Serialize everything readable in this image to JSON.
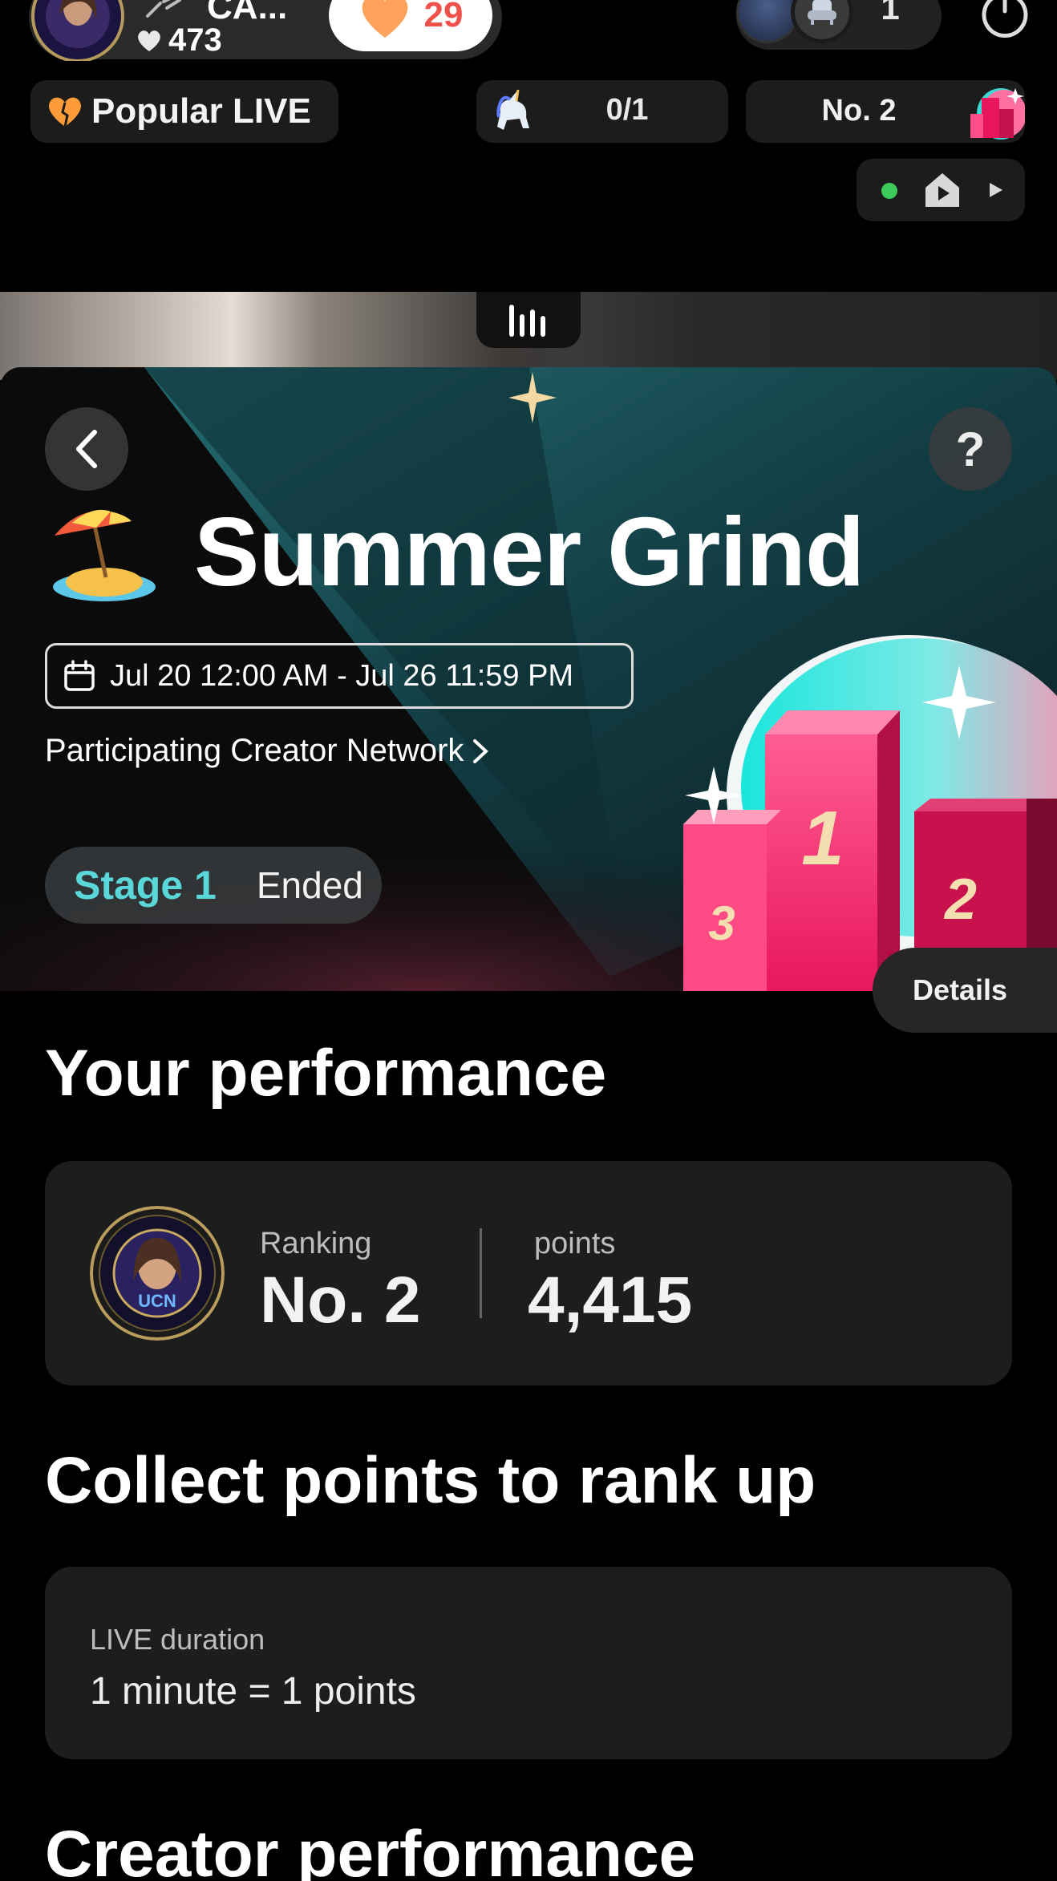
{
  "live_header": {
    "host_name": "CA...",
    "host_likes": "473",
    "heart_count": "29",
    "viewer_count": "1",
    "popular_label": "Popular LIVE",
    "unicorn_progress": "0/1",
    "rank_label": "No. 2"
  },
  "banner": {
    "title": "Summer Grind",
    "date_range": "Jul 20 12:00 AM - Jul 26 11:59 PM",
    "network_link": "Participating Creator Network",
    "stage_name": "Stage 1",
    "stage_status": "Ended",
    "help_label": "?",
    "details_label": "Details",
    "podium_labels": [
      "1",
      "2",
      "3"
    ]
  },
  "performance": {
    "section_title": "Your performance",
    "ranking_label": "Ranking",
    "ranking_value": "No. 2",
    "points_label": "points",
    "points_value": "4,415",
    "avatar_badge_text": "UCN"
  },
  "collect": {
    "section_title": "Collect points to rank up",
    "rule_label": "LIVE duration",
    "rule_value": "1 minute = 1 points"
  },
  "creator": {
    "section_title": "Creator performance"
  },
  "colors": {
    "accent_teal": "#5ad7d8",
    "heart_red": "#f0504a",
    "podium_pink": "#e8175d",
    "live_green": "#3ccb5a"
  },
  "icons": [
    "power-icon",
    "heart-icon",
    "unicorn-icon",
    "home-icon",
    "play-icon",
    "back-chevron-icon",
    "calendar-icon",
    "chevron-right-icon",
    "beach-umbrella-icon",
    "sparkle-icon"
  ]
}
